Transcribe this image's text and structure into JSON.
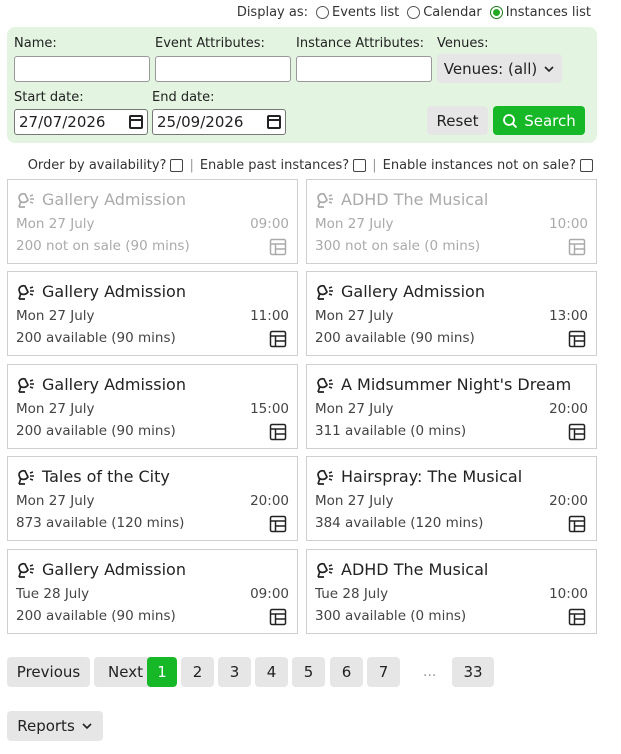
{
  "display_as": {
    "label": "Display as:",
    "options": [
      {
        "label": "Events list",
        "selected": false
      },
      {
        "label": "Calendar",
        "selected": false
      },
      {
        "label": "Instances list",
        "selected": true
      }
    ]
  },
  "filters": {
    "name_label": "Name:",
    "name_value": "",
    "event_attr_label": "Event Attributes:",
    "event_attr_value": "",
    "instance_attr_label": "Instance Attributes:",
    "instance_attr_value": "",
    "venues_label": "Venues:",
    "venues_value": "Venues: (all)",
    "start_label": "Start date:",
    "start_value": "27/07/2026",
    "end_label": "End date:",
    "end_value": "25/09/2026",
    "reset_label": "Reset",
    "search_label": "Search"
  },
  "options": {
    "order_by": "Order by availability?",
    "past": "Enable past instances?",
    "not_on_sale": "Enable instances not on sale?"
  },
  "instances": [
    {
      "title": "Gallery Admission",
      "date": "Mon 27 July",
      "time": "09:00",
      "availability": "200 not on sale (90 mins)",
      "faded": true
    },
    {
      "title": "ADHD The Musical",
      "date": "Mon 27 July",
      "time": "10:00",
      "availability": "300 not on sale (0 mins)",
      "faded": true
    },
    {
      "title": "Gallery Admission",
      "date": "Mon 27 July",
      "time": "11:00",
      "availability": "200 available (90 mins)",
      "faded": false
    },
    {
      "title": "Gallery Admission",
      "date": "Mon 27 July",
      "time": "13:00",
      "availability": "200 available (90 mins)",
      "faded": false
    },
    {
      "title": "Gallery Admission",
      "date": "Mon 27 July",
      "time": "15:00",
      "availability": "200 available (90 mins)",
      "faded": false
    },
    {
      "title": "A Midsummer Night's Dream",
      "date": "Mon 27 July",
      "time": "20:00",
      "availability": "311 available (0 mins)",
      "faded": false
    },
    {
      "title": "Tales of the City",
      "date": "Mon 27 July",
      "time": "20:00",
      "availability": "873 available (120 mins)",
      "faded": false
    },
    {
      "title": "Hairspray: The Musical",
      "date": "Mon 27 July",
      "time": "20:00",
      "availability": "384 available (120 mins)",
      "faded": false
    },
    {
      "title": "Gallery Admission",
      "date": "Tue 28 July",
      "time": "09:00",
      "availability": "200 available (90 mins)",
      "faded": false
    },
    {
      "title": "ADHD The Musical",
      "date": "Tue 28 July",
      "time": "10:00",
      "availability": "300 available (0 mins)",
      "faded": false
    }
  ],
  "pagination": {
    "previous": "Previous",
    "next": "Next",
    "pages": [
      "1",
      "2",
      "3",
      "4",
      "5",
      "6",
      "7"
    ],
    "ellipsis": "...",
    "last": "33",
    "current": "1"
  },
  "reports_label": "Reports",
  "colors": {
    "accent": "#17b827",
    "filter_bg": "#e3f5e1"
  },
  "icons": {
    "instance": "lamp-icon",
    "seating": "table-grid-icon",
    "search": "search-icon",
    "dropdown": "chevron-down-icon"
  }
}
